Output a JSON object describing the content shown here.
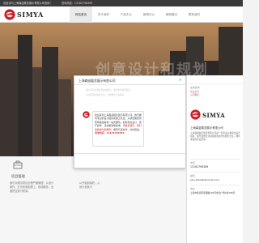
{
  "topbar": {
    "company": "欢迎访问上海森滋展览展示有限公司官网！",
    "phone": "咨询热线：13162796369"
  },
  "brand": {
    "name": "SIMYA",
    "accent": "#c8202a"
  },
  "nav": {
    "items": [
      "网站首页",
      "关于我们",
      "产品中心",
      "新闻中心",
      "案例展示",
      "联系我们"
    ]
  },
  "hero": {
    "title": "创意设计和规划"
  },
  "project": {
    "title": "项目管理",
    "desc": "我们对展览项目全程严格管理，从设计制作、灯光布置到施工、现场服务，全面把控执行质量。",
    "desc_right": "从开始到最终，从设计到执行"
  },
  "modal": {
    "title": "上海森滋展览展示有限公司",
    "close": "×",
    "faint_1": "...我公司平台你好您在此留言，我们会尽快回复您",
    "faint_2": "...可填写您的联系方式，方便我们与您联系",
    "message_lead": "欢迎来到上海森滋展览展示有限公司，我们拥有专业的设计团队和施工队伍，从项目策划到现场搭建提供一站式服务。如有展台设计、展厅装修、活动策划等需求，",
    "message_highlight": "请联系我们，我们将竭诚为您服务！",
    "message_tail": "期待与您合作，共创佳绩。",
    "consult": "咨询电话：13162796369"
  },
  "side": {
    "tabs": [
      "在线咨询",
      "企业名片",
      "公司简介"
    ],
    "company": "上海森滋展览展示有限公司",
    "desc": "上海森滋展览展示有限公司是一家专业从事展台设计搭建、展厅装修及活动策划的综合性服务企业，拥有丰富的行业经验。",
    "phone_label": "电话",
    "phone": "13162796369",
    "email_label": "邮箱",
    "email": "yixu.zhan@simya-sh.com",
    "address_label": "地址",
    "address": "上海市嘉定区嘉涌路199号金龙广场C座706室"
  }
}
